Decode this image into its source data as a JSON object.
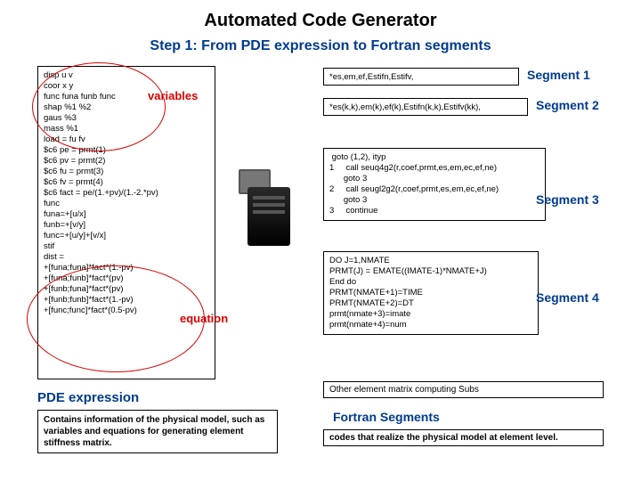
{
  "title": "Automated Code Generator",
  "subtitle": "Step 1: From PDE expression to Fortran segments",
  "pde_box": "disp u v\ncoor x y\nfunc funa funb func\nshap %1 %2\ngaus %3\nmass %1\nload = fu fv\n$c6 pe = prmt(1)\n$c6 pv = prmt(2)\n$c6 fu = prmt(3)\n$c6 fv = prmt(4)\n$c6 fact = pe/(1.+pv)/(1.-2.*pv)\nfunc\nfuna=+[u/x]\nfunb=+[v/y]\nfunc=+[u/y]+[v/x]\nstif\ndist =\n+[funa;funa]*fact*(1.-pv)\n+[funa;funb]*fact*(pv)\n+[funb;funa]*fact*(pv)\n+[funb;funb]*fact*(1.-pv)\n+[func;func]*fact*(0.5-pv)",
  "labels": {
    "variables": "variables",
    "equation": "equation"
  },
  "segments": {
    "s1": "*es,em,ef,Estifn,Estifv,",
    "s2": "*es(k,k),em(k),ef(k),Estifn(k,k),Estifv(kk),",
    "s3": " goto (1,2), ityp\n1     call seuq4g2(r,coef,prmt,es,em,ec,ef,ne)\n      goto 3\n2     call seugl2g2(r,coef,prmt,es,em,ec,ef,ne)\n      goto 3\n3     continue",
    "s4": "DO J=1,NMATE\nPRMT(J) = EMATE((IMATE-1)*NMATE+J)\nEnd do\nPRMT(NMATE+1)=TIME\nPRMT(NMATE+2)=DT\nprmt(nmate+3)=imate\nprmt(nmate+4)=num",
    "l1": "Segment 1",
    "l2": "Segment 2",
    "l3": "Segment 3",
    "l4": "Segment 4"
  },
  "other_subs": "Other element matrix computing Subs",
  "pde_expr_title": "PDE expression",
  "pde_expr_desc": "Contains information of the physical model, such as variables and equations for generating element stiffness matrix.",
  "fortran_title": "Fortran Segments",
  "fortran_desc": "codes that realize the physical model at element level."
}
